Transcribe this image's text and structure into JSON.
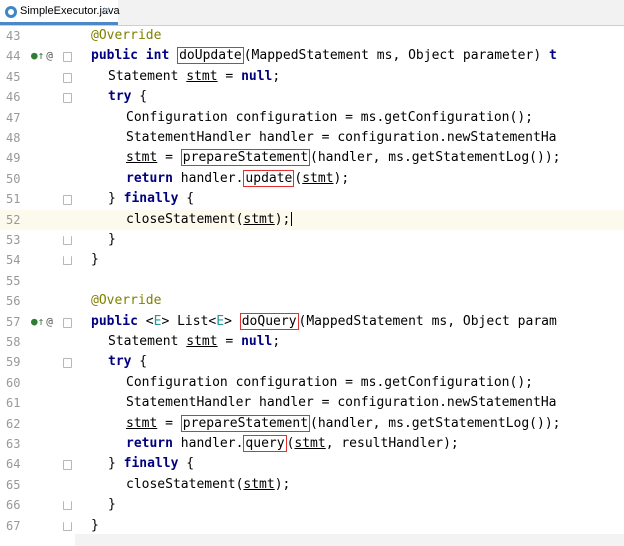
{
  "tab": {
    "label": "SimpleExecutor.java",
    "close": "×"
  },
  "lines": [
    {
      "n": "43",
      "ind": 0,
      "parts": [
        {
          "t": "@Override",
          "c": "ann"
        }
      ]
    },
    {
      "n": "44",
      "ind": 0,
      "marks": true,
      "parts": [
        {
          "t": "public",
          "c": "kw"
        },
        {
          "t": " "
        },
        {
          "t": "int",
          "c": "kw"
        },
        {
          "t": " "
        },
        {
          "t": "doUpdate",
          "c": "hl"
        },
        {
          "t": "(MappedStatement ms, Object parameter) "
        },
        {
          "t": "t",
          "c": "kw"
        }
      ]
    },
    {
      "n": "45",
      "ind": 1,
      "fold": "start",
      "parts": [
        {
          "t": "Statement "
        },
        {
          "t": "stmt",
          "c": "ul"
        },
        {
          "t": " = "
        },
        {
          "t": "null",
          "c": "kw"
        },
        {
          "t": ";"
        }
      ]
    },
    {
      "n": "46",
      "ind": 1,
      "fold": "start",
      "parts": [
        {
          "t": "try",
          "c": "kw"
        },
        {
          "t": " {"
        }
      ]
    },
    {
      "n": "47",
      "ind": 2,
      "parts": [
        {
          "t": "Configuration configuration = ms.getConfiguration();"
        }
      ]
    },
    {
      "n": "48",
      "ind": 2,
      "parts": [
        {
          "t": "StatementHandler handler = configuration.newStatementHa"
        }
      ]
    },
    {
      "n": "49",
      "ind": 2,
      "parts": [
        {
          "t": "stmt",
          "c": "ul"
        },
        {
          "t": " = "
        },
        {
          "t": "prepareStatement",
          "c": "hl"
        },
        {
          "t": "(handler, ms.getStatementLog());"
        }
      ]
    },
    {
      "n": "50",
      "ind": 2,
      "parts": [
        {
          "t": "return",
          "c": "kw"
        },
        {
          "t": " handler."
        },
        {
          "t": "update",
          "c": "hl"
        },
        {
          "t": "("
        },
        {
          "t": "stmt",
          "c": "ul"
        },
        {
          "t": ");"
        }
      ]
    },
    {
      "n": "51",
      "ind": 1,
      "fold": "start",
      "parts": [
        {
          "t": "} "
        },
        {
          "t": "finally",
          "c": "kw"
        },
        {
          "t": " {"
        }
      ]
    },
    {
      "n": "52",
      "ind": 2,
      "current": true,
      "parts": [
        {
          "t": "closeStatement("
        },
        {
          "t": "stmt",
          "c": "ul"
        },
        {
          "t": ");"
        },
        {
          "c": "caret"
        }
      ]
    },
    {
      "n": "53",
      "ind": 1,
      "fold": "end",
      "parts": [
        {
          "t": "}"
        }
      ]
    },
    {
      "n": "54",
      "ind": 0,
      "fold": "end",
      "parts": [
        {
          "t": "}"
        }
      ]
    },
    {
      "n": "55",
      "ind": 0,
      "parts": []
    },
    {
      "n": "56",
      "ind": 0,
      "parts": [
        {
          "t": "@Override",
          "c": "ann"
        }
      ]
    },
    {
      "n": "57",
      "ind": 0,
      "marks": true,
      "parts": [
        {
          "t": "public",
          "c": "kw"
        },
        {
          "t": " <"
        },
        {
          "t": "E",
          "c": "tp"
        },
        {
          "t": "> List<"
        },
        {
          "t": "E",
          "c": "tp"
        },
        {
          "t": "> "
        },
        {
          "t": "doQuery",
          "c": "hl"
        },
        {
          "t": "(MappedStatement ms, Object param"
        }
      ]
    },
    {
      "n": "58",
      "ind": 1,
      "parts": [
        {
          "t": "Statement "
        },
        {
          "t": "stmt",
          "c": "ul"
        },
        {
          "t": " = "
        },
        {
          "t": "null",
          "c": "kw"
        },
        {
          "t": ";"
        }
      ]
    },
    {
      "n": "59",
      "ind": 1,
      "fold": "start",
      "parts": [
        {
          "t": "try",
          "c": "kw"
        },
        {
          "t": " {"
        }
      ]
    },
    {
      "n": "60",
      "ind": 2,
      "parts": [
        {
          "t": "Configuration configuration = ms.getConfiguration();"
        }
      ]
    },
    {
      "n": "61",
      "ind": 2,
      "parts": [
        {
          "t": "StatementHandler handler = configuration.newStatementHa"
        }
      ]
    },
    {
      "n": "62",
      "ind": 2,
      "parts": [
        {
          "t": "stmt",
          "c": "ul"
        },
        {
          "t": " = "
        },
        {
          "t": "prepareStatement",
          "c": "hl"
        },
        {
          "t": "(handler, ms.getStatementLog());"
        }
      ]
    },
    {
      "n": "63",
      "ind": 2,
      "parts": [
        {
          "t": "return",
          "c": "kw"
        },
        {
          "t": " handler."
        },
        {
          "t": "query",
          "c": "hl"
        },
        {
          "t": "("
        },
        {
          "t": "stmt",
          "c": "ul"
        },
        {
          "t": ", resultHandler);"
        }
      ]
    },
    {
      "n": "64",
      "ind": 1,
      "fold": "start",
      "parts": [
        {
          "t": "} "
        },
        {
          "t": "finally",
          "c": "kw"
        },
        {
          "t": " {"
        }
      ]
    },
    {
      "n": "65",
      "ind": 2,
      "parts": [
        {
          "t": "closeStatement("
        },
        {
          "t": "stmt",
          "c": "ul"
        },
        {
          "t": ");"
        }
      ]
    },
    {
      "n": "66",
      "ind": 1,
      "fold": "end",
      "parts": [
        {
          "t": "}"
        }
      ]
    },
    {
      "n": "67",
      "ind": 0,
      "fold": "end",
      "parts": [
        {
          "t": "}"
        }
      ]
    }
  ],
  "gutter_icons": {
    "override": "override-method-icon",
    "annotation": "@"
  },
  "colors": {
    "keyword": "#000080",
    "annotation": "#808000",
    "type_param": "#20999d",
    "highlight_box": "#e03030",
    "current_line": "#fcfaed"
  }
}
